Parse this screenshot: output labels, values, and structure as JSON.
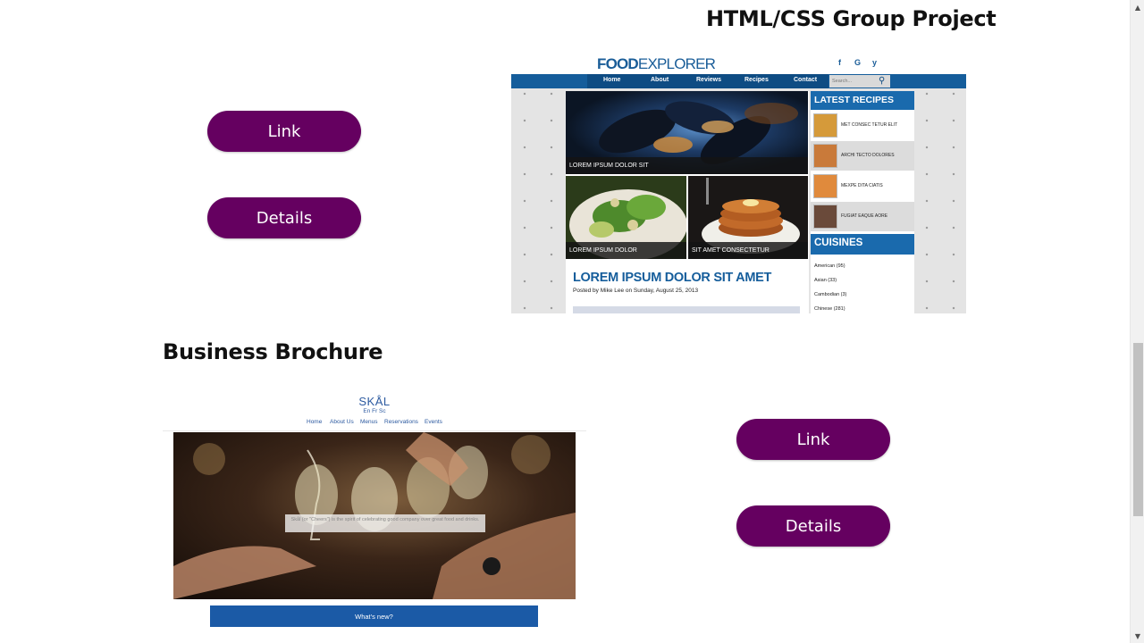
{
  "projects": [
    {
      "title": "HTML/CSS Group Project",
      "link_label": "Link",
      "details_label": "Details",
      "preview": {
        "logo_bold": "FOOD",
        "logo_light": "EXPLORER",
        "social": [
          "f",
          "G",
          "y"
        ],
        "nav": [
          "Home",
          "About",
          "Reviews",
          "Recipes",
          "Contact"
        ],
        "search_placeholder": "Search...",
        "captions": [
          "LOREM IPSUM DOLOR SIT",
          "LOREM IPSUM DOLOR",
          "SIT AMET CONSECTETUR"
        ],
        "article_title": "LOREM IPSUM DOLOR SIT AMET",
        "article_meta": "Posted by Mike Lee on Sunday, August 25, 2013",
        "latest_title": "LATEST RECIPES",
        "recipes": [
          "MET CONSEC TETUR ELIT",
          "ARCHI TECTO DOLORES",
          "MEXPE DITA CIATIS",
          "FUGIAT EAQUE AORE"
        ],
        "cuisines_title": "CUISINES",
        "cuisines": [
          "American (95)",
          "Asian (33)",
          "Cambodian (3)",
          "Chinese (281)"
        ]
      }
    },
    {
      "title": "Business Brochure",
      "link_label": "Link",
      "details_label": "Details",
      "preview": {
        "logo": "SKÅL",
        "languages": "En Fr Sc",
        "nav": [
          "Home",
          "About Us",
          "Menus",
          "Reservations",
          "Events"
        ],
        "quote": "Skål (or \"Cheers\") is the spirit of celebrating good company over great food and drinks.",
        "cta": "What's new?"
      }
    }
  ],
  "colors": {
    "button": "#650060",
    "foodexplorer_blue": "#155d9b",
    "skal_blue": "#1b5aa6"
  }
}
